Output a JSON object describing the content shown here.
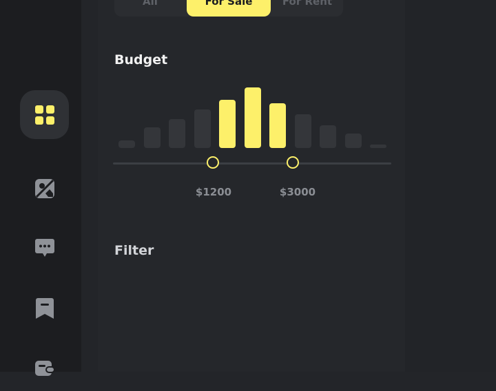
{
  "tabs": [
    {
      "label": "All",
      "active": false
    },
    {
      "label": "For Sale",
      "active": true
    },
    {
      "label": "For Rent",
      "active": false
    }
  ],
  "budget": {
    "title": "Budget",
    "histogram": [
      6,
      17,
      24,
      32,
      40,
      50,
      37,
      28,
      19,
      12,
      3
    ],
    "selected_range_bars": [
      4,
      6
    ],
    "min_label": "$1200",
    "max_label": "$3000"
  },
  "filter": {
    "title": "Filter"
  },
  "sidebar": {
    "items": [
      {
        "icon": "grid-icon",
        "active": true
      },
      {
        "icon": "map-image-icon",
        "active": false
      },
      {
        "icon": "chat-icon",
        "active": false
      },
      {
        "icon": "bookmark-icon",
        "active": false
      },
      {
        "icon": "wallet-icon",
        "active": false
      }
    ]
  },
  "colors": {
    "accent": "#fdf06a",
    "background": "#232529",
    "sidebar": "#1c1d20",
    "icon": "#8f9298"
  }
}
